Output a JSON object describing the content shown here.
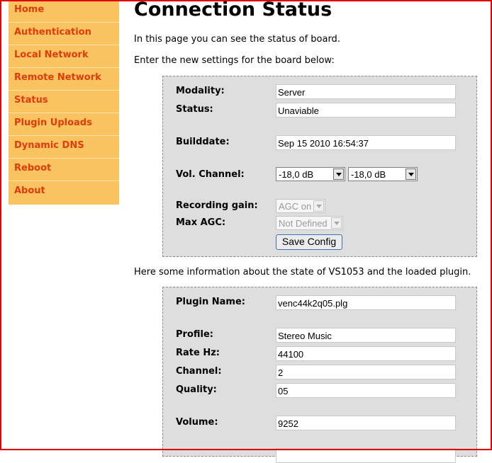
{
  "sidebar": {
    "items": [
      {
        "label": "Home"
      },
      {
        "label": "Authentication"
      },
      {
        "label": "Local Network"
      },
      {
        "label": "Remote Network"
      },
      {
        "label": "Status"
      },
      {
        "label": "Plugin Uploads"
      },
      {
        "label": "Dynamic DNS"
      },
      {
        "label": "Reboot"
      },
      {
        "label": "About"
      }
    ]
  },
  "page": {
    "title": "Connection Status",
    "intro": "In this page you can see the status of board.",
    "settings_intro": "Enter the new settings for the board below:",
    "plugin_intro": "Here some information about the state of VS1053 and the loaded plugin."
  },
  "board": {
    "modality_label": "Modality:",
    "modality_value": "Server",
    "status_label": "Status:",
    "status_value": "Unaviable",
    "builddate_label": "Builddate:",
    "builddate_value": "Sep 15 2010 16:54:37",
    "vol_label": "Vol. Channel:",
    "vol_left": "-18,0 dB",
    "vol_right": "-18,0 dB",
    "rec_gain_label": "Recording gain:",
    "rec_gain_value": "AGC on",
    "max_agc_label": "Max AGC:",
    "max_agc_value": "Not Defined",
    "save_label": "Save Config"
  },
  "plugin": {
    "name_label": "Plugin Name:",
    "name_value": "venc44k2q05.plg",
    "profile_label": "Profile:",
    "profile_value": "Stereo Music",
    "rate_label": "Rate Hz:",
    "rate_value": "44100",
    "channel_label": "Channel:",
    "channel_value": "2",
    "quality_label": "Quality:",
    "quality_value": "05",
    "volume_label": "Volume:",
    "volume_value": "9252"
  },
  "colors": {
    "nav_bg": "#f9c35f",
    "nav_text": "#e23a0c",
    "panel_bg": "#dedede",
    "window_border": "#e00000"
  }
}
